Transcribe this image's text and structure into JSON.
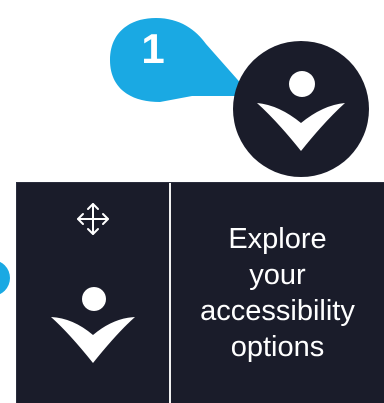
{
  "callout": {
    "step_number": "1",
    "color": "#1aa9e3"
  },
  "launcher": {
    "icon": "accessibility-person-icon",
    "background": "#1a1c2a"
  },
  "panel": {
    "move_icon": "move-arrows-icon",
    "logo_icon": "accessibility-person-icon",
    "label_lines": [
      "Explore",
      "your",
      "accessibility",
      "options"
    ],
    "background": "#1a1c2a"
  }
}
